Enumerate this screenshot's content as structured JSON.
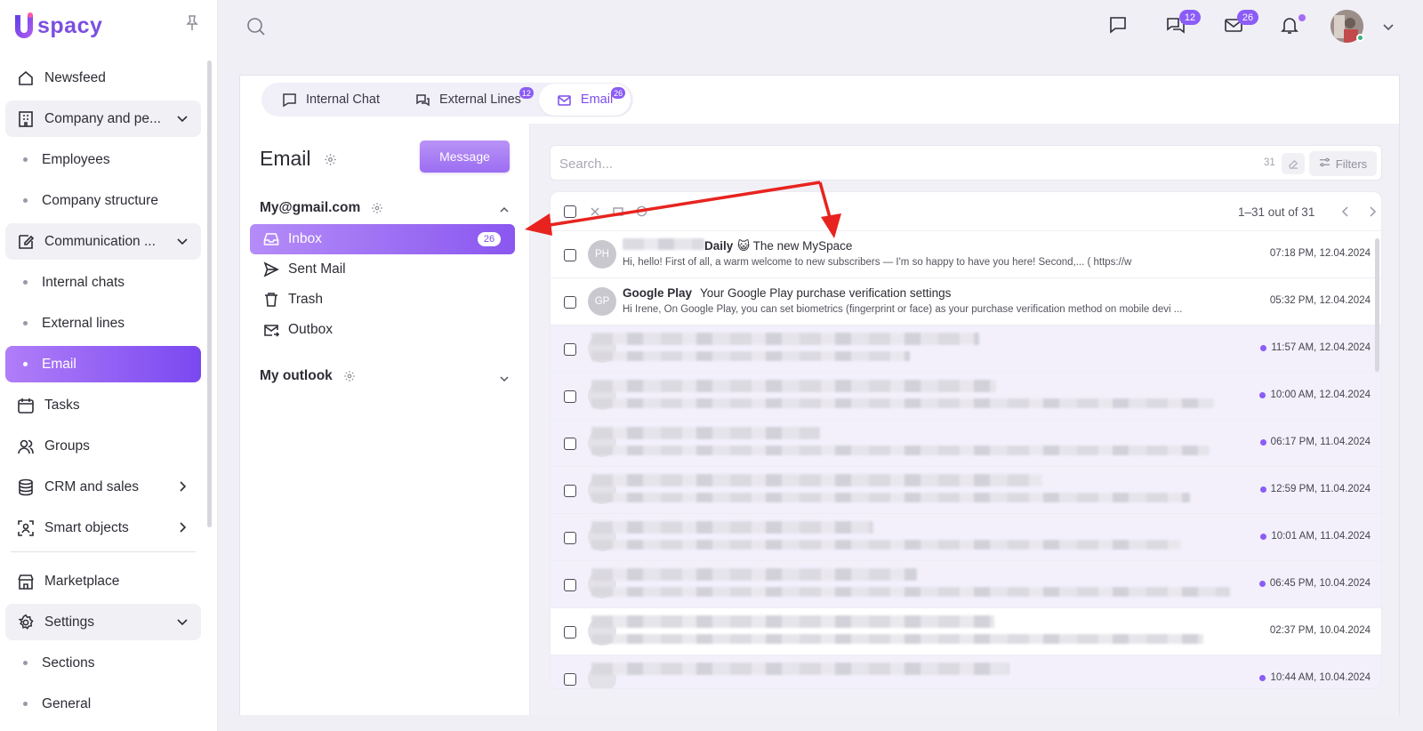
{
  "app": {
    "logo_text": "spacy",
    "brand_color": "#8b5cf6"
  },
  "sidebar": {
    "items": [
      {
        "label": "Newsfeed",
        "icon": "home-icon",
        "type": "item"
      },
      {
        "label": "Company and pe...",
        "icon": "building-icon",
        "type": "group",
        "expanded": true
      },
      {
        "label": "Employees",
        "type": "sub"
      },
      {
        "label": "Company structure",
        "type": "sub"
      },
      {
        "label": "Communication ...",
        "icon": "chat-edit-icon",
        "type": "group",
        "expanded": true
      },
      {
        "label": "Internal chats",
        "type": "sub"
      },
      {
        "label": "External lines",
        "type": "sub"
      },
      {
        "label": "Email",
        "type": "sub",
        "active": true
      },
      {
        "label": "Tasks",
        "icon": "calendar-icon",
        "type": "item"
      },
      {
        "label": "Groups",
        "icon": "people-icon",
        "type": "item"
      },
      {
        "label": "CRM and sales",
        "icon": "database-icon",
        "type": "item",
        "chevron": "right"
      },
      {
        "label": "Smart objects",
        "icon": "scan-icon",
        "type": "item",
        "chevron": "right"
      },
      {
        "label": "Marketplace",
        "icon": "store-icon",
        "type": "item"
      },
      {
        "label": "Settings",
        "icon": "gear-icon",
        "type": "group",
        "expanded": true
      },
      {
        "label": "Sections",
        "type": "sub"
      },
      {
        "label": "General",
        "type": "sub"
      }
    ]
  },
  "topbar": {
    "chats_badge": "12",
    "mail_badge": "26"
  },
  "tabs": [
    {
      "label": "Internal Chat",
      "icon": "chat-bubble-icon",
      "badge": ""
    },
    {
      "label": "External Lines",
      "icon": "chats-icon",
      "badge": "12"
    },
    {
      "label": "Email",
      "icon": "envelope-icon",
      "badge": "26",
      "active": true
    }
  ],
  "email_panel": {
    "title": "Email",
    "message_button": "Message",
    "accounts": [
      {
        "name": "My@gmail.com",
        "expanded": true
      },
      {
        "name": "My outlook",
        "expanded": false
      }
    ],
    "folders": [
      {
        "label": "Inbox",
        "icon": "inbox-icon",
        "badge": "26",
        "active": true
      },
      {
        "label": "Sent Mail",
        "icon": "send-icon",
        "badge": ""
      },
      {
        "label": "Trash",
        "icon": "trash-icon",
        "badge": ""
      },
      {
        "label": "Outbox",
        "icon": "outbox-icon",
        "badge": ""
      }
    ]
  },
  "search": {
    "placeholder": "Search...",
    "count": "31",
    "filters_label": "Filters"
  },
  "list": {
    "range": "1–31 out of 31",
    "rows": [
      {
        "initials": "PH",
        "sender": "Daily",
        "subject": "😺 The new MySpace",
        "preview": "Hi, hello! First of all, a warm welcome to new subscribers — I'm so happy to have you here! Second,...                 ( https://w",
        "time": "07:18 PM, 12.04.2024",
        "unread": false,
        "blurred": false
      },
      {
        "initials": "GP",
        "sender": "Google Play",
        "subject": "Your Google Play purchase verification settings",
        "preview": "Hi Irene,    On Google Play, you can set biometrics (fingerprint or face) as your  purchase verification method on mobile devi ...",
        "time": "05:32 PM, 12.04.2024",
        "unread": false,
        "blurred": false
      },
      {
        "time": "11:57 AM, 12.04.2024",
        "unread": true,
        "blurred": true
      },
      {
        "time": "10:00 AM, 12.04.2024",
        "unread": true,
        "blurred": true
      },
      {
        "time": "06:17 PM, 11.04.2024",
        "unread": true,
        "blurred": true
      },
      {
        "time": "12:59 PM, 11.04.2024",
        "unread": true,
        "blurred": true
      },
      {
        "time": "10:01 AM, 11.04.2024",
        "unread": true,
        "blurred": true
      },
      {
        "time": "06:45 PM, 10.04.2024",
        "unread": true,
        "blurred": true
      },
      {
        "time": "02:37 PM, 10.04.2024",
        "unread": false,
        "blurred": true
      },
      {
        "time": "10:44 AM, 10.04.2024",
        "unread": true,
        "blurred": true
      }
    ]
  }
}
